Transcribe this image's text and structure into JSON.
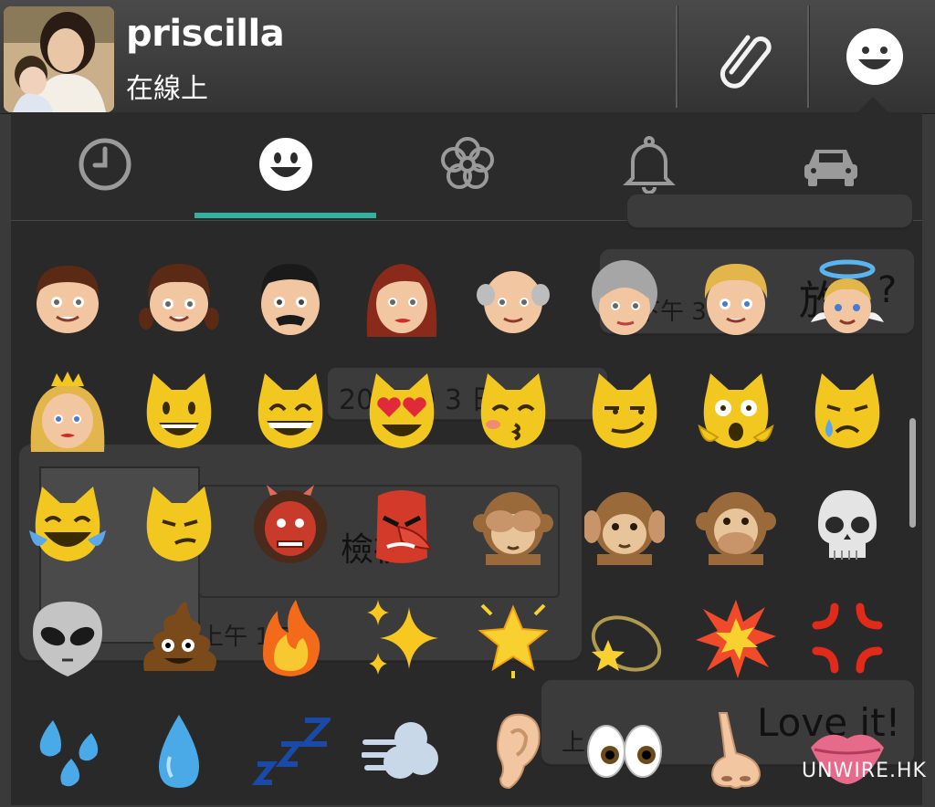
{
  "header": {
    "contact_name": "priscilla",
    "contact_status": "在線上",
    "attach_icon": "paperclip-icon",
    "emoji_icon": "smiley-icon"
  },
  "tabs": [
    {
      "icon": "recent-clock-icon",
      "selected": false
    },
    {
      "icon": "smiley-face-icon",
      "selected": true
    },
    {
      "icon": "flower-icon",
      "selected": false
    },
    {
      "icon": "bell-icon",
      "selected": false
    },
    {
      "icon": "car-icon",
      "selected": false
    }
  ],
  "accent_color": "#2fb3a0",
  "background_chat": {
    "msg1_text": "放",
    "msg1_suffix": "?",
    "msg1_time": "下午 3:5",
    "date_text": "20  年 9   3 日",
    "msg2_text": "檢視",
    "msg2_time": "上午 1  5",
    "msg3_text": "Love it!",
    "msg3_time": "上   48"
  },
  "emoji_rows": [
    [
      "boy-emoji",
      "girl-emoji",
      "man-emoji",
      "woman-emoji",
      "older-man-emoji",
      "older-woman-emoji",
      "person-blond-emoji",
      "angel-emoji"
    ],
    [
      "princess-emoji",
      "smiley-cat-emoji",
      "grinning-cat-emoji",
      "heart-eyes-cat-emoji",
      "kissing-cat-emoji",
      "smirk-cat-emoji",
      "scream-cat-emoji",
      "crying-cat-emoji"
    ],
    [
      "joy-cat-emoji",
      "pouting-cat-emoji",
      "japanese-ogre-emoji",
      "japanese-goblin-emoji",
      "see-no-evil-monkey-emoji",
      "hear-no-evil-monkey-emoji",
      "speak-no-evil-monkey-emoji",
      "skull-emoji"
    ],
    [
      "alien-emoji",
      "poop-emoji",
      "fire-emoji",
      "sparkles-emoji",
      "glowing-star-emoji",
      "dizzy-emoji",
      "collision-emoji",
      "anger-emoji"
    ],
    [
      "sweat-drops-emoji",
      "droplet-emoji",
      "zzz-emoji",
      "dash-emoji",
      "ear-emoji",
      "eyes-emoji",
      "nose-emoji",
      "lips-emoji"
    ]
  ],
  "watermark": "UNWIRE.HK"
}
